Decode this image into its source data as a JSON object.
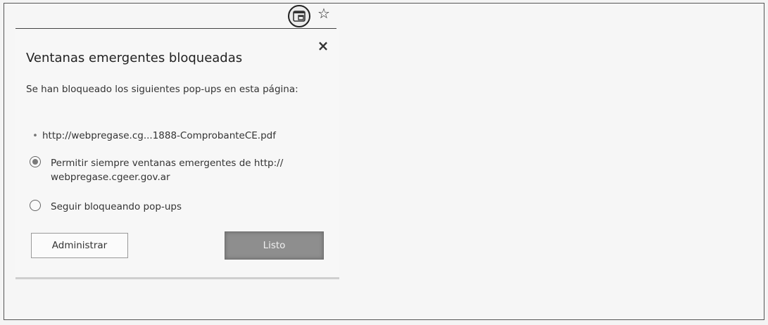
{
  "toolbar": {
    "popup_blocked_icon": "popup-blocked-icon",
    "star_icon": "star-icon",
    "star_glyph": "☆"
  },
  "bubble": {
    "close_glyph": "×",
    "title": "Ventanas emergentes bloqueadas",
    "description": "Se han bloqueado los siguientes pop-ups en esta página:",
    "bullet": "•",
    "blocked_items": [
      "http://webpregase.cg...1888-ComprobanteCE.pdf"
    ],
    "options": [
      {
        "label": "Permitir siempre ventanas emergentes de http:// webpregase.cgeer.gov.ar",
        "selected": true
      },
      {
        "label": "Seguir bloqueando pop-ups",
        "selected": false
      }
    ],
    "manage_label": "Administrar",
    "done_label": "Listo"
  }
}
